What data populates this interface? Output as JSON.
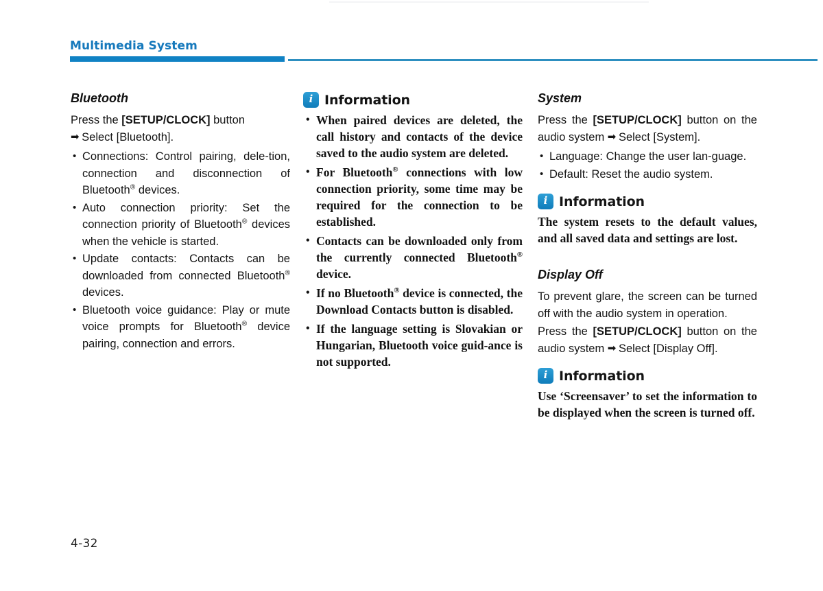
{
  "page": {
    "chapter_header": "Multimedia System",
    "folio": "4-32",
    "accent_color": "#1082c4",
    "header_text_color": "#1679bc"
  },
  "columns": {
    "left": {
      "section_title": "Bluetooth",
      "intro_line1_pre": "Press the ",
      "intro_line1_bold": "[SETUP/CLOCK]",
      "intro_line1_post": " button",
      "arrow_icon": "➡",
      "intro_line2": " Select [Bluetooth].",
      "bullets": [
        {
          "pre": "Connections: Control pairing, dele-tion, connection and disconnection of Bluetooth",
          "reg": "®",
          "post": " devices."
        },
        {
          "pre": "Auto connection priority: Set the connection priority of Bluetooth",
          "reg": "®",
          "post": " devices when the vehicle is started."
        },
        {
          "pre": "Update contacts: Contacts can be downloaded from connected Bluetooth",
          "reg": "®",
          "post": " devices."
        },
        {
          "pre": "Bluetooth voice guidance: Play or mute voice prompts for Bluetooth",
          "reg": "®",
          "post": " device pairing, connection and errors."
        }
      ]
    },
    "middle": {
      "info": {
        "icon_letter": "i",
        "title": "Information",
        "bullets": [
          {
            "pre": "When paired devices are deleted, the call history and contacts of the device saved to the audio system are deleted.",
            "reg": "",
            "post": ""
          },
          {
            "pre": "For Bluetooth",
            "reg": "®",
            "post": " connections with low connection priority, some time may be required for the connection to be established."
          },
          {
            "pre": "Contacts can be downloaded only from the currently connected Bluetooth",
            "reg": "®",
            "post": " device."
          },
          {
            "pre": "If no Bluetooth",
            "reg": "®",
            "post": " device is connected, the Download Contacts button is disabled."
          },
          {
            "pre": "If the language setting is Slovakian or Hungarian, Bluetooth voice guid-ance is not supported.",
            "reg": "",
            "post": ""
          }
        ]
      }
    },
    "right": {
      "system": {
        "section_title": "System",
        "intro_pre": "Press the ",
        "intro_bold": "[SETUP/CLOCK]",
        "intro_mid": " button on the audio system ",
        "arrow_icon": "➡",
        "intro_post": " Select [System].",
        "bullets": [
          "Language: Change the user lan-guage.",
          "Default: Reset the audio system."
        ]
      },
      "info_1": {
        "icon_letter": "i",
        "title": "Information",
        "text": "The system resets to the default values, and all saved data and settings are lost."
      },
      "display_off": {
        "section_title": "Display Off",
        "paragraph": "To prevent glare, the screen can be turned off with the audio system in operation.",
        "press_pre": "Press the ",
        "press_bold": "[SETUP/CLOCK]",
        "press_mid": " button on the audio system ",
        "arrow_icon": "➡",
        "press_post": " Select [Display Off]."
      },
      "info_2": {
        "icon_letter": "i",
        "title": "Information",
        "text": "Use ‘Screensaver’ to set the information to be displayed when the screen is turned off."
      }
    }
  }
}
